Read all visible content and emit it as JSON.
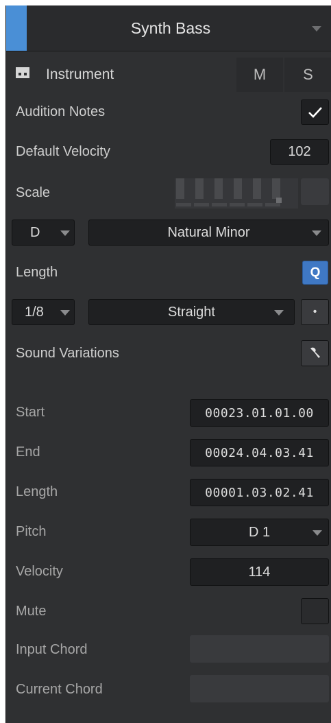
{
  "header": {
    "title": "Synth Bass",
    "accent_color": "#4a8fd6"
  },
  "instrument_row": {
    "label": "Instrument",
    "mute_label": "M",
    "solo_label": "S",
    "icon": "keyboard-icon"
  },
  "audition": {
    "label": "Audition Notes",
    "checked": true
  },
  "default_velocity": {
    "label": "Default Velocity",
    "value": "102"
  },
  "scale": {
    "label": "Scale",
    "key": "D",
    "type": "Natural Minor"
  },
  "length_section": {
    "label": "Length",
    "quantize_label": "Q",
    "division": "1/8",
    "mode": "Straight",
    "dot_label": "•"
  },
  "sound_variations": {
    "label": "Sound Variations",
    "icon": "wrench-icon"
  },
  "note_props": {
    "start_label": "Start",
    "start_value": "00023.01.01.00",
    "end_label": "End",
    "end_value": "00024.04.03.41",
    "length_label": "Length",
    "length_value": "00001.03.02.41",
    "pitch_label": "Pitch",
    "pitch_value": "D 1",
    "velocity_label": "Velocity",
    "velocity_value": "114",
    "mute_label": "Mute",
    "input_chord_label": "Input Chord",
    "current_chord_label": "Current Chord"
  }
}
